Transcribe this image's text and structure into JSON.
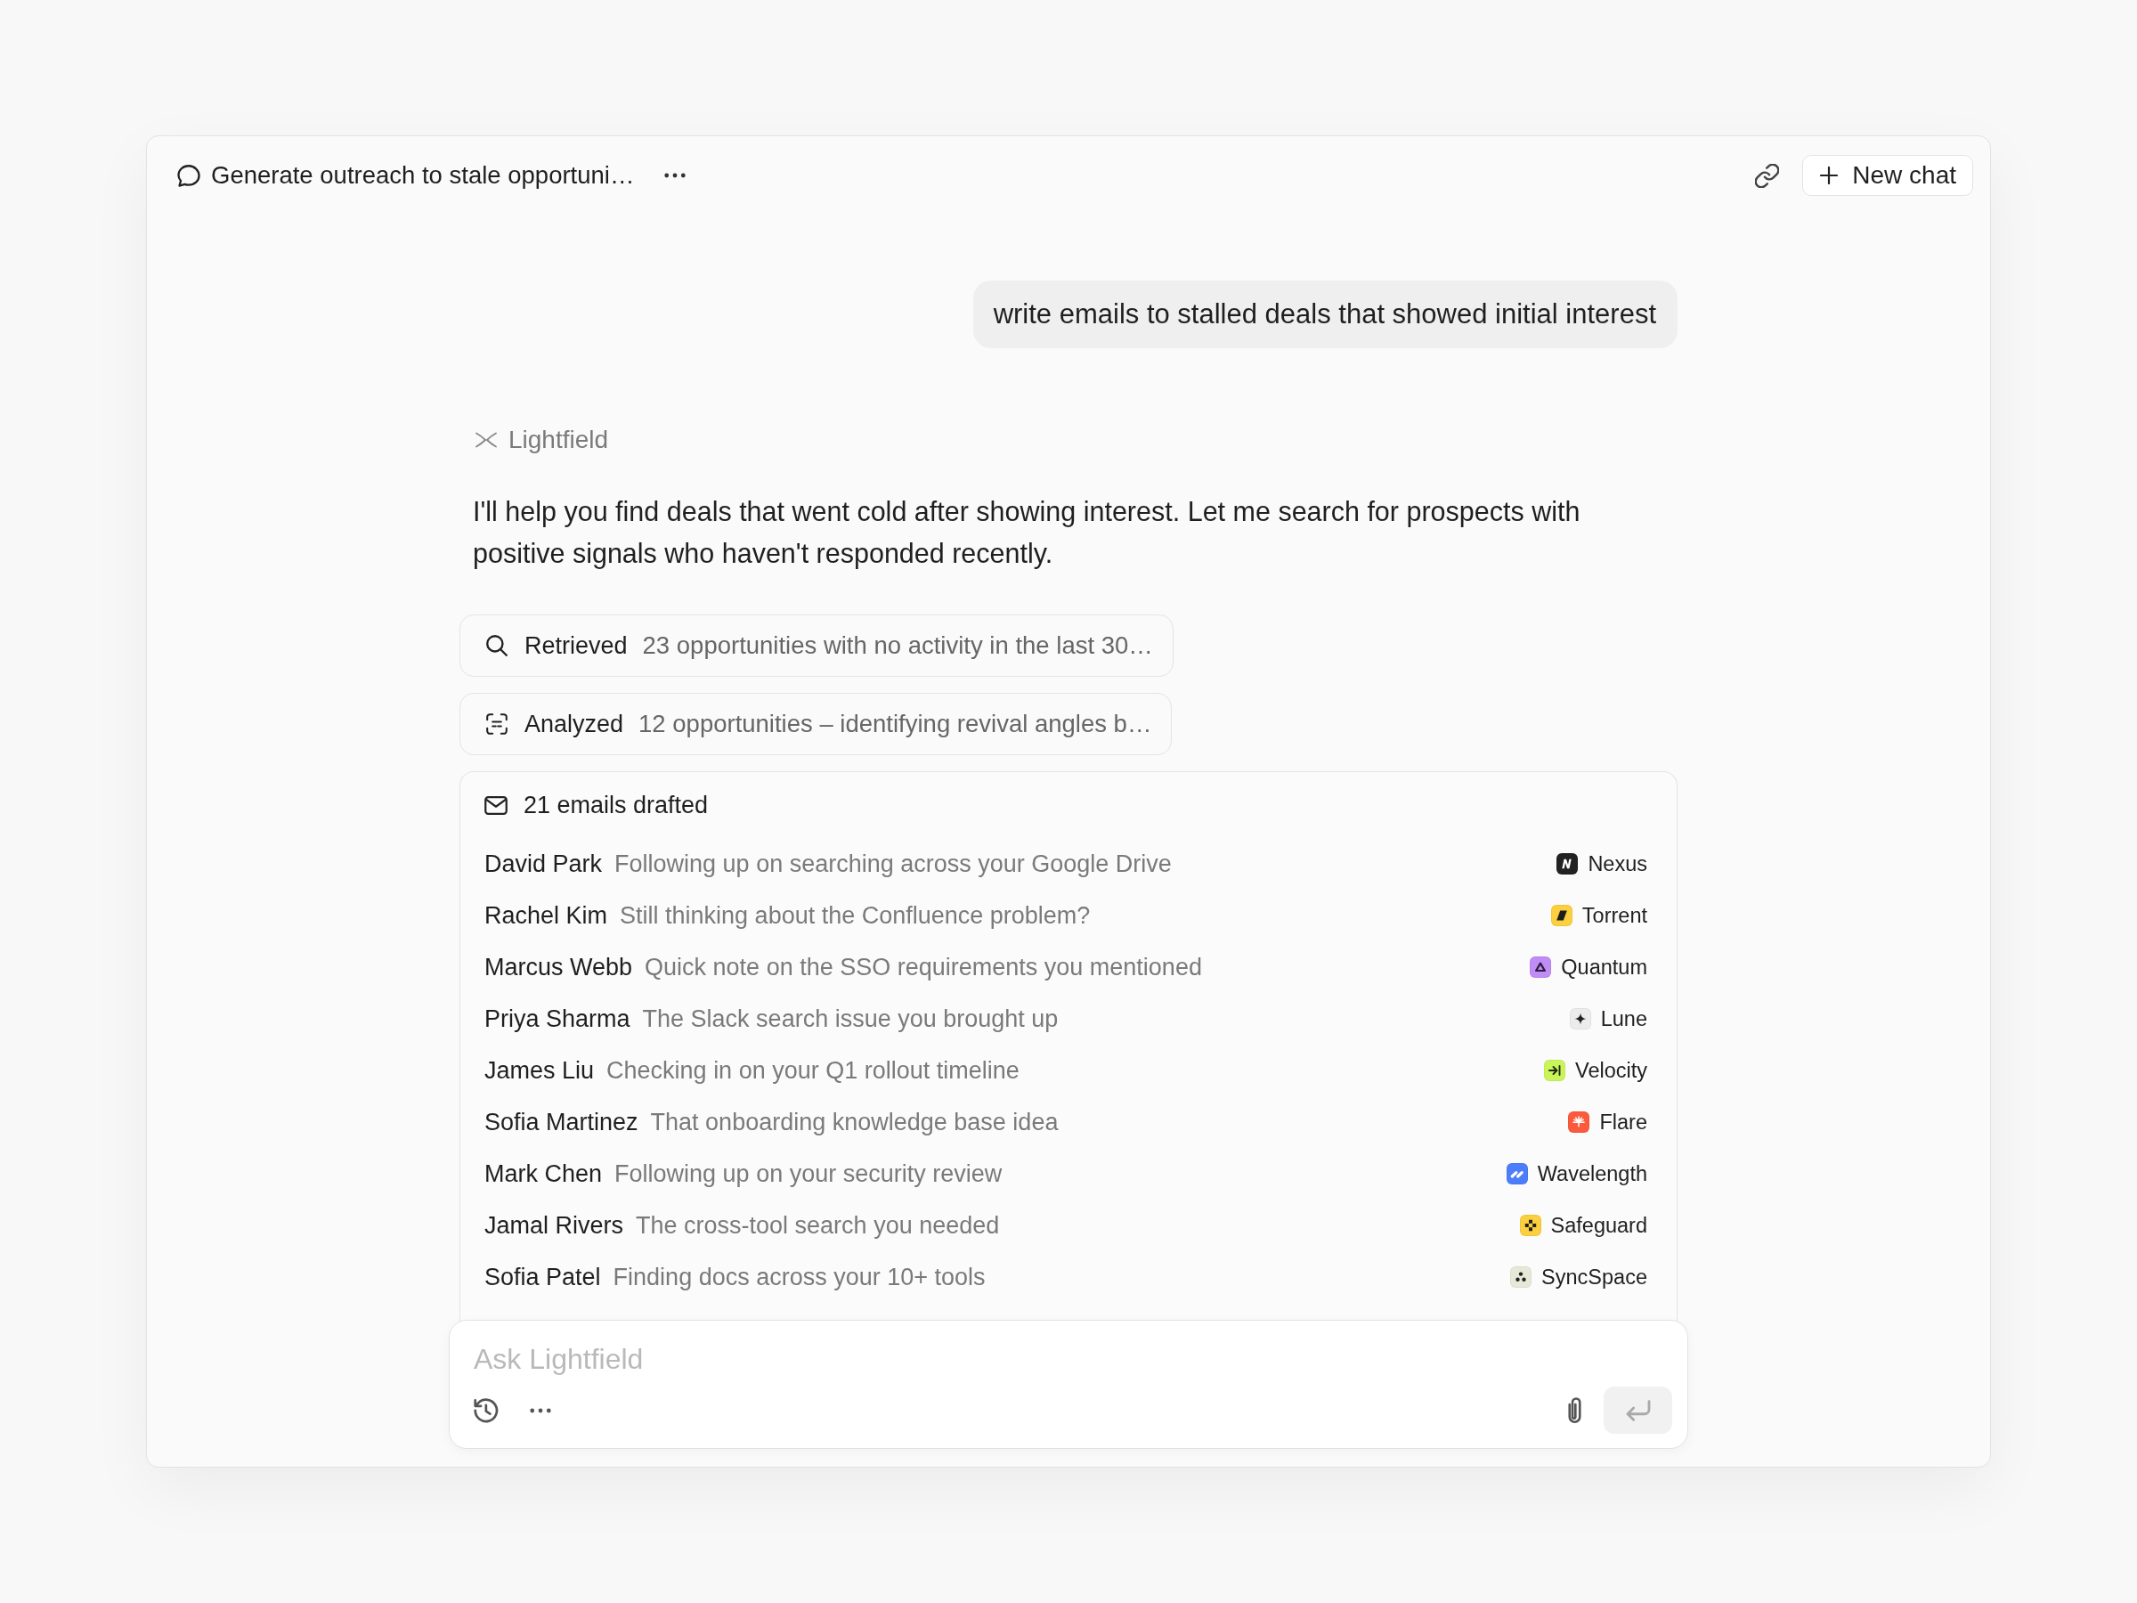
{
  "header": {
    "title": "Generate outreach to stale opportuni…",
    "new_chat_label": "New chat"
  },
  "user_message": "write emails to stalled deals that showed initial interest",
  "assistant": {
    "name": "Lightfield",
    "text": "I'll help you find deals that went cold after showing interest. Let me search for prospects with positive signals who haven't responded recently."
  },
  "steps": [
    {
      "kind": "search",
      "label": "Retrieved",
      "detail": "23 opportunities with no activity in the last 30…"
    },
    {
      "kind": "analyze",
      "label": "Analyzed",
      "detail": "12 opportunities – identifying revival angles b…"
    }
  ],
  "drafts": {
    "title": "21 emails drafted",
    "items": [
      {
        "name": "David Park",
        "subject": "Following up on searching across your Google Drive",
        "company": {
          "name": "Nexus",
          "kind": "monogram",
          "color": "#222222"
        }
      },
      {
        "name": "Rachel Kim",
        "subject": "Still thinking about the Confluence problem?",
        "company": {
          "name": "Torrent",
          "kind": "parallelogram",
          "color": "#fbcf3e"
        }
      },
      {
        "name": "Marcus Webb",
        "subject": "Quick note on the SSO requirements you mentioned",
        "company": {
          "name": "Quantum",
          "kind": "triangle",
          "color": "#c08cf5"
        }
      },
      {
        "name": "Priya Sharma",
        "subject": "The Slack search issue you brought up",
        "company": {
          "name": "Lune",
          "kind": "sparkle",
          "color": "#ececec"
        }
      },
      {
        "name": "James Liu",
        "subject": "Checking in on your Q1 rollout timeline",
        "company": {
          "name": "Velocity",
          "kind": "arrow-bar",
          "color": "#c9f55b"
        }
      },
      {
        "name": "Sofia Martinez",
        "subject": "That onboarding knowledge base idea",
        "company": {
          "name": "Flare",
          "kind": "sunburst",
          "color": "#fb5b3c"
        }
      },
      {
        "name": "Mark Chen",
        "subject": "Following up on your security review",
        "company": {
          "name": "Wavelength",
          "kind": "stripes",
          "color": "#4c7dfb"
        }
      },
      {
        "name": "Jamal Rivers",
        "subject": "The cross-tool search you needed",
        "company": {
          "name": "Safeguard",
          "kind": "cross",
          "color": "#fbcf3e"
        }
      },
      {
        "name": "Sofia Patel",
        "subject": "Finding docs across your 10+ tools",
        "company": {
          "name": "SyncSpace",
          "kind": "dots",
          "color": "#e7e9d8"
        }
      }
    ]
  },
  "composer": {
    "placeholder": "Ask Lightfield",
    "send_button": {
      "disabled": true
    }
  }
}
